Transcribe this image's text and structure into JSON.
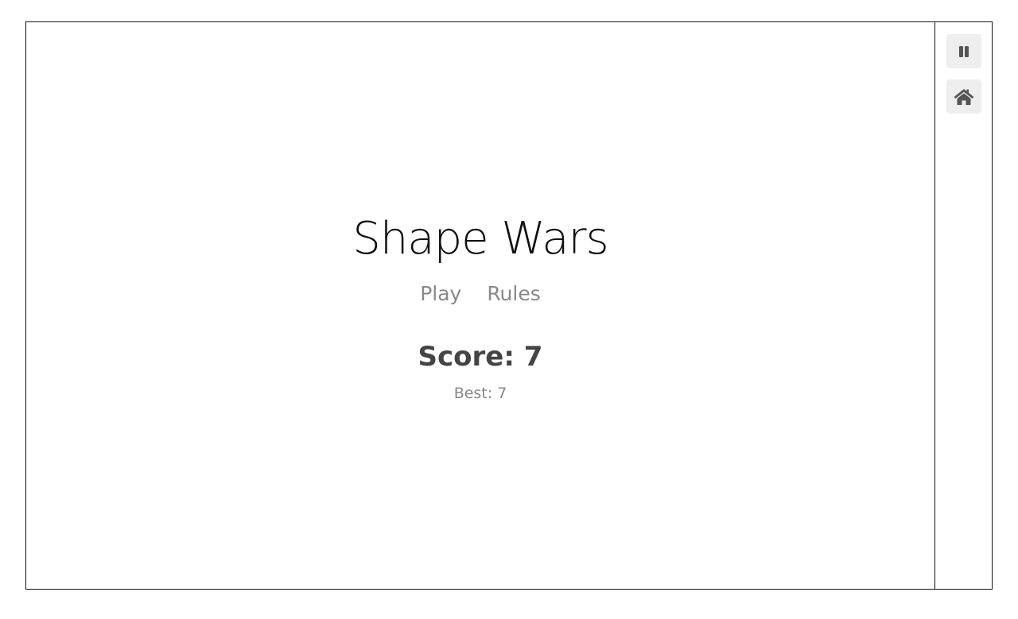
{
  "game": {
    "title": "Shape Wars",
    "menu": {
      "play_label": "Play",
      "rules_label": "Rules"
    },
    "score_text": "Score: 7",
    "best_text": "Best: 7"
  },
  "sidebar": {
    "pause_icon": "pause-icon",
    "home_icon": "home-icon"
  },
  "colors": {
    "border": "#111111",
    "button_bg": "#eeeeee",
    "icon": "#555555",
    "muted_text": "#888888",
    "score_text": "#444444"
  }
}
